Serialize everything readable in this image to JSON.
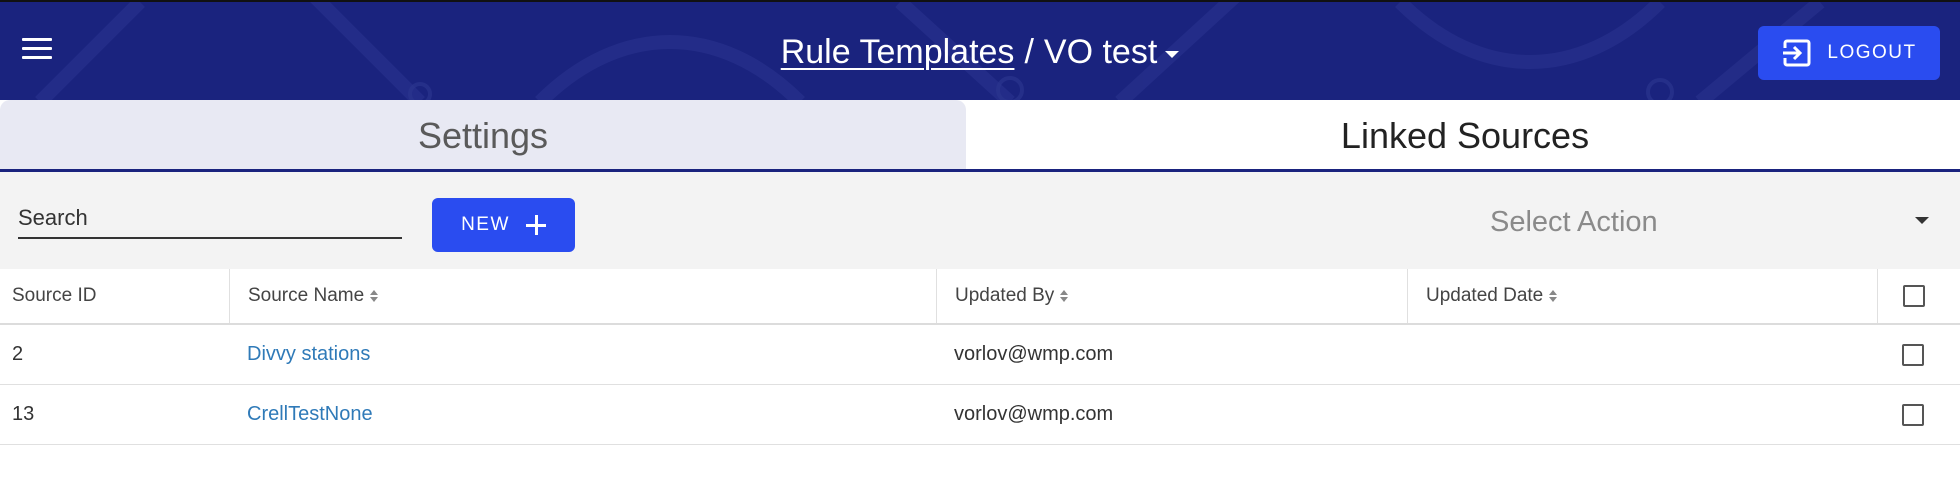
{
  "header": {
    "breadcrumb_link": "Rule Templates",
    "separator": "/",
    "current": "VO test",
    "logout_label": "LOGOUT",
    "background_color": "#1a237e"
  },
  "tabs": [
    {
      "label": "Settings",
      "active": false
    },
    {
      "label": "Linked Sources",
      "active": true
    }
  ],
  "toolbar": {
    "search_placeholder": "Search",
    "search_value": "",
    "new_label": "NEW",
    "select_action_placeholder": "Select Action",
    "button_color": "#2a4cf0"
  },
  "table": {
    "columns": [
      {
        "label": "Source ID",
        "sortable": false
      },
      {
        "label": "Source Name",
        "sortable": true
      },
      {
        "label": "Updated By",
        "sortable": true
      },
      {
        "label": "Updated Date",
        "sortable": true
      }
    ],
    "rows": [
      {
        "source_id": "2",
        "source_name": "Divvy stations",
        "updated_by": "vorlov@wmp.com",
        "updated_date": ""
      },
      {
        "source_id": "13",
        "source_name": "CrellTestNone",
        "updated_by": "vorlov@wmp.com",
        "updated_date": ""
      }
    ],
    "link_color": "#2f7ab8"
  },
  "icons": {
    "menu": "hamburger-menu-icon",
    "logout": "logout-icon",
    "add": "plus-icon",
    "dropdown": "caret-down-icon",
    "sort": "sort-icon"
  }
}
